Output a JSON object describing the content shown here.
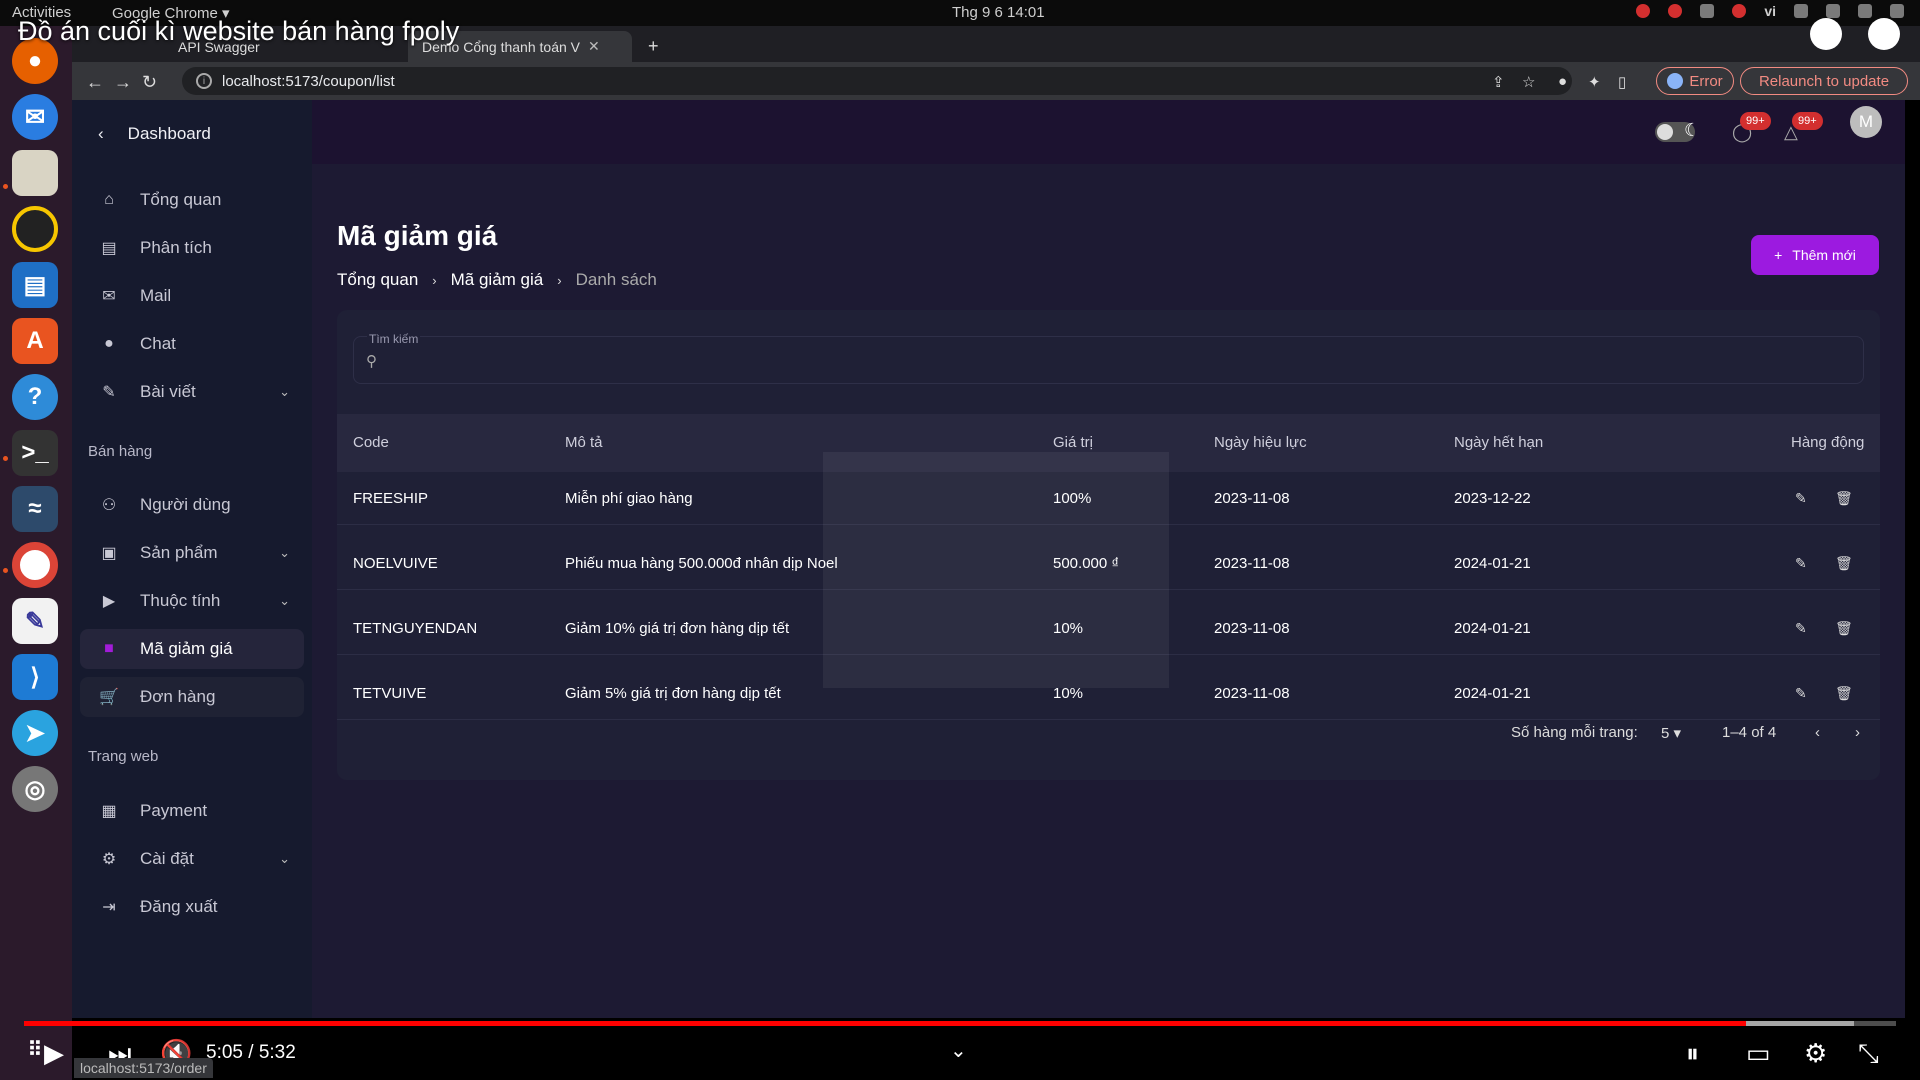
{
  "system": {
    "activities": "Activities",
    "app_menu": "Google Chrome ▾",
    "clock": "Thg 9 6  14:01",
    "language": "vi"
  },
  "video": {
    "title": "Đồ án cuối kì website bán hàng fpoly",
    "time": "5:05 / 5:32",
    "progress": 0.92
  },
  "browser": {
    "tabs": [
      {
        "label": "API Swagger"
      },
      {
        "label": "Demo Cổng thanh toán V"
      }
    ],
    "new_tab": "+",
    "url": "localhost:5173/coupon/list",
    "error_label": "Error",
    "relaunch_label": "Relaunch to update",
    "status_url": "localhost:5173/order"
  },
  "sidebar": {
    "header": "Dashboard",
    "items_main": [
      {
        "label": "Tổng quan",
        "icon": "home-icon",
        "glyph": "⌂"
      },
      {
        "label": "Phân tích",
        "icon": "analytics-icon",
        "glyph": "▤"
      },
      {
        "label": "Mail",
        "icon": "mail-icon",
        "glyph": "✉"
      },
      {
        "label": "Chat",
        "icon": "chat-icon",
        "glyph": "●"
      },
      {
        "label": "Bài viết",
        "icon": "post-icon",
        "glyph": "✎"
      }
    ],
    "section_sales": "Bán hàng",
    "items_sales": [
      {
        "label": "Người dùng",
        "icon": "users-icon",
        "glyph": "⚇"
      },
      {
        "label": "Sản phẩm",
        "icon": "shopping-bag-icon",
        "glyph": "▣"
      },
      {
        "label": "Thuộc tính",
        "icon": "tag-icon",
        "glyph": "▶"
      },
      {
        "label": "Mã giảm giá",
        "icon": "coupon-icon",
        "glyph": "■"
      },
      {
        "label": "Đơn hàng",
        "icon": "cart-icon",
        "glyph": "🛒"
      }
    ],
    "section_web": "Trang web",
    "items_web": [
      {
        "label": "Payment",
        "icon": "payment-icon",
        "glyph": "▦"
      },
      {
        "label": "Cài đặt",
        "icon": "settings-icon",
        "glyph": "⚙"
      },
      {
        "label": "Đăng xuất",
        "icon": "logout-icon",
        "glyph": "⇥"
      }
    ]
  },
  "header": {
    "chat_badge": "99+",
    "notification_badge": "99+",
    "avatar_letter": "M"
  },
  "page": {
    "title": "Mã giảm giá",
    "breadcrumb": [
      "Tổng quan",
      "Mã giảm giá",
      "Danh sách"
    ],
    "add_button": "Thêm mới",
    "search_label": "Tìm kiếm"
  },
  "table": {
    "columns": [
      "Code",
      "Mô tả",
      "Giá trị",
      "Ngày hiệu lực",
      "Ngày hết hạn",
      "Hàng động"
    ],
    "rows": [
      {
        "code": "FREESHIP",
        "desc": "Miễn phí giao hàng",
        "value": "100%",
        "start": "2023-11-08",
        "end": "2023-12-22"
      },
      {
        "code": "NOELVUIVE",
        "desc": "Phiếu mua hàng 500.000đ nhân dịp Noel",
        "value": "500.000 ₫",
        "start": "2023-11-08",
        "end": "2024-01-21"
      },
      {
        "code": "TETNGUYENDAN",
        "desc": "Giảm 10% giá trị đơn hàng dịp tết",
        "value": "10%",
        "start": "2023-11-08",
        "end": "2024-01-21"
      },
      {
        "code": "TETVUIVE",
        "desc": "Giảm 5% giá trị đơn hàng dịp tết",
        "value": "10%",
        "start": "2023-11-08",
        "end": "2024-01-21"
      }
    ]
  },
  "pagination": {
    "rows_per_page_label": "Số hàng mỗi trang:",
    "rows_per_page": "5",
    "range": "1–4 of 4"
  },
  "colors": {
    "accent": "#9c1ae0",
    "sidebar_bg": "#161a2e",
    "content_bg": "#1d1a33",
    "card_bg": "#1f2036",
    "progress": "#ff0000"
  }
}
